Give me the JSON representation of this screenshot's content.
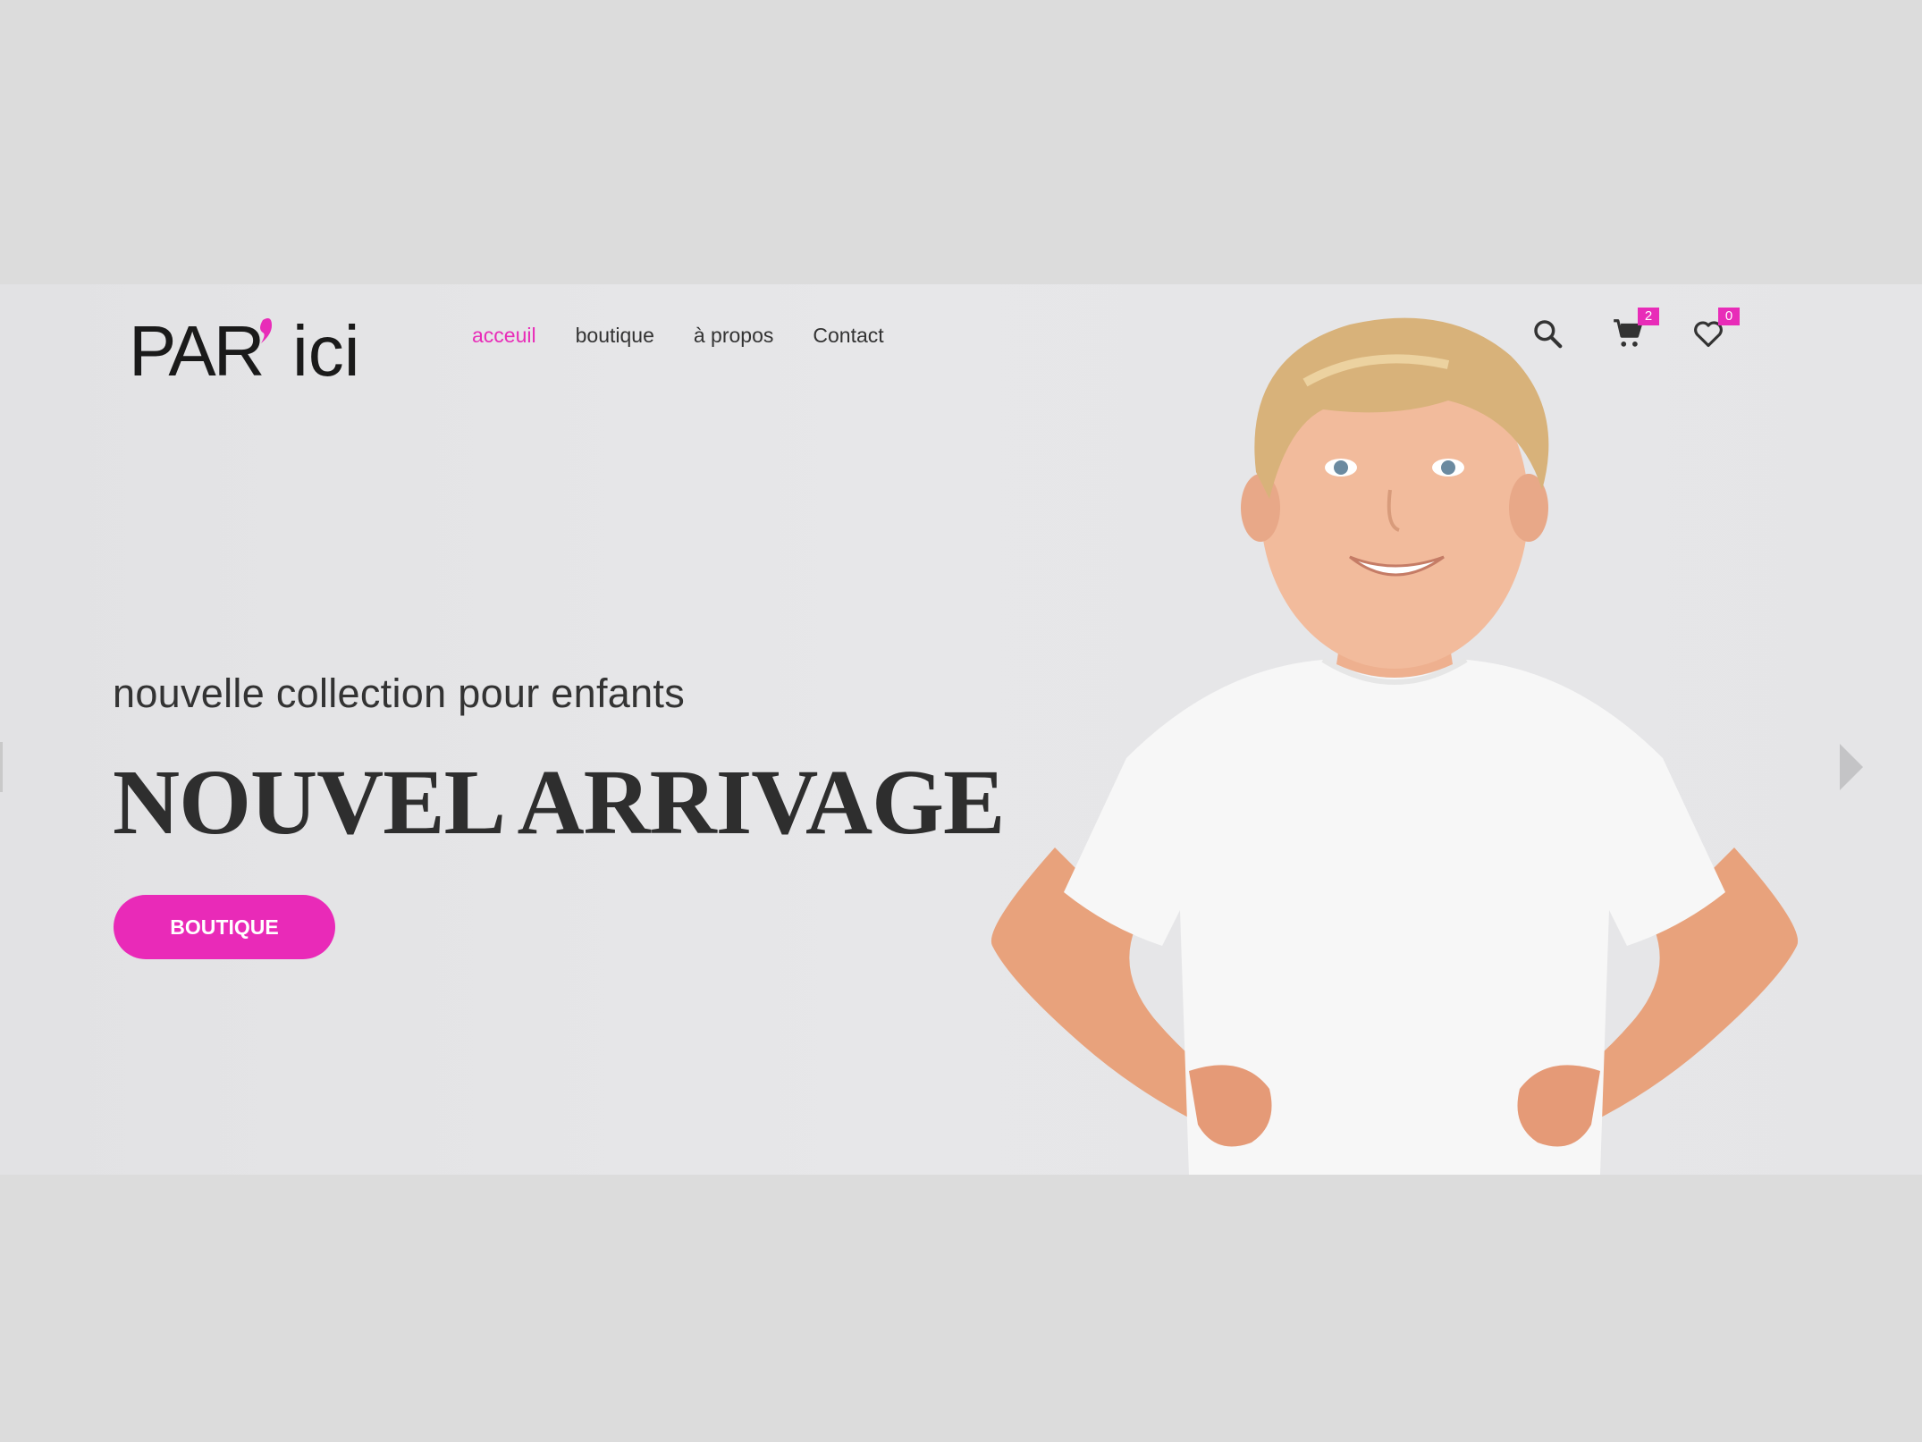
{
  "header": {
    "logo_text_main": "PAR",
    "logo_text_accent": "ici",
    "nav": [
      {
        "label": "acceuil",
        "active": true
      },
      {
        "label": "boutique",
        "active": false
      },
      {
        "label": "à propos",
        "active": false
      },
      {
        "label": "Contact",
        "active": false
      }
    ],
    "icons": {
      "search": "search-icon",
      "cart": "cart-icon",
      "wishlist": "heart-icon"
    },
    "cart_count": "2",
    "wishlist_count": "0"
  },
  "hero": {
    "subtitle": "nouvelle collection pour enfants",
    "title": "NOUVEL ARRIVAGE",
    "button_label": "BOUTIQUE"
  },
  "colors": {
    "accent": "#e82cb8",
    "text": "#333333",
    "background": "#dcdcdc"
  }
}
